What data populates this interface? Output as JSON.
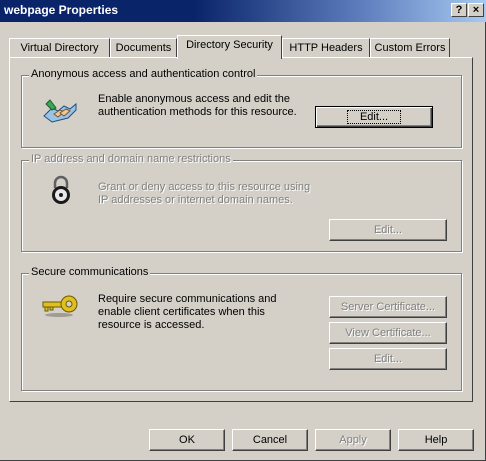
{
  "window": {
    "title": "webpage Properties",
    "help_glyph": "?",
    "close_glyph": "×"
  },
  "tabs": [
    {
      "label": "Virtual Directory"
    },
    {
      "label": "Documents"
    },
    {
      "label": "Directory Security",
      "active": true
    },
    {
      "label": "HTTP Headers"
    },
    {
      "label": "Custom Errors"
    }
  ],
  "anonymous": {
    "legend": "Anonymous access and authentication control",
    "description_line1": "Enable anonymous access and edit the",
    "description_line2": "authentication methods for this resource.",
    "edit_label": "Edit..."
  },
  "ip": {
    "legend": "IP address and domain name restrictions",
    "description_line1": "Grant or deny access to this resource using",
    "description_line2": "IP addresses or internet domain names.",
    "edit_label": "Edit..."
  },
  "secure": {
    "legend": "Secure communications",
    "description_line1": "Require secure communications and",
    "description_line2": "enable client certificates when this",
    "description_line3": "resource is accessed.",
    "server_cert_label": "Server Certificate...",
    "view_cert_label": "View Certificate...",
    "edit_label": "Edit..."
  },
  "footer": {
    "ok": "OK",
    "cancel": "Cancel",
    "apply": "Apply",
    "help": "Help"
  },
  "colors": {
    "title_bar": "#0a246a",
    "face": "#d4d0c8",
    "disabled_text": "#808080"
  },
  "icons": [
    "handshake-icon",
    "padlock-icon",
    "key-icon",
    "help-icon",
    "close-icon"
  ]
}
